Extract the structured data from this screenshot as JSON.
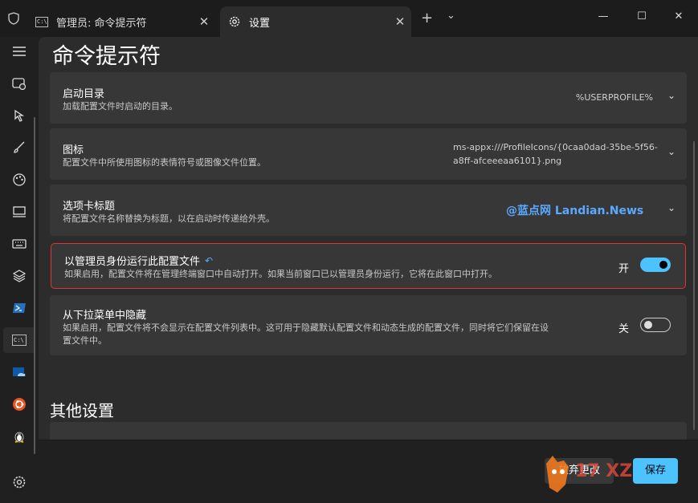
{
  "titlebar": {
    "tabs": [
      {
        "label": "管理员: 命令提示符",
        "icon": "cmd-icon",
        "close": "✕"
      },
      {
        "label": "设置",
        "icon": "gear-icon",
        "close": "✕"
      }
    ],
    "new_tab": "+",
    "dropdown": "⌄",
    "minimize": "—",
    "maximize": "☐",
    "close": "✕"
  },
  "sidebar": {
    "items": [
      {
        "name": "menu-icon"
      },
      {
        "name": "startup-icon"
      },
      {
        "name": "interaction-icon"
      },
      {
        "name": "appearance-icon"
      },
      {
        "name": "color-schemes-icon"
      },
      {
        "name": "rendering-icon"
      },
      {
        "name": "actions-icon"
      },
      {
        "name": "defaults-icon"
      },
      {
        "name": "powershell-icon"
      },
      {
        "name": "cmd-profile-icon"
      },
      {
        "name": "azure-icon"
      },
      {
        "name": "ubuntu-icon"
      },
      {
        "name": "linux-icon"
      },
      {
        "name": "settings-icon"
      }
    ],
    "active_index": 9
  },
  "main": {
    "title": "命令提示符",
    "cards": [
      {
        "title": "启动目录",
        "desc": "加载配置文件时启动的目录。",
        "value": "%USERPROFILE%"
      },
      {
        "title": "图标",
        "desc": "配置文件中所使用图标的表情符号或图像文件位置。",
        "value_line1": "ms-appx:///ProfileIcons/{0caa0dad-35be-5f56-",
        "value_line2": "a8ff-afceeeaa6101}.png"
      },
      {
        "title": "选项卡标题",
        "desc": "将配置文件名称替换为标题，以在启动时传递给外壳。",
        "watermark": "@蓝点网 Landian.News"
      },
      {
        "title": "以管理员身份运行此配置文件",
        "desc": "如果启用，配置文件将在管理终端窗口中自动打开。如果当前窗口已以管理员身份运行，它将在此窗口中打开。",
        "toggle_label": "开",
        "toggle_on": true
      },
      {
        "title": "从下拉菜单中隐藏",
        "desc_line1": "如果启用，配置文件将不会显示在配置文件列表中。这可用于隐藏默认配置文件和动态生成的配置文件，同时将它们保留在设",
        "desc_line2": "置文件中。",
        "toggle_label": "关",
        "toggle_on": false
      }
    ],
    "section_title": "其他设置"
  },
  "footer": {
    "discard": "放弃更改",
    "save": "保存"
  },
  "colors": {
    "accent": "#4cc2ff",
    "highlight_border": "#e63333",
    "card_bg": "#373737",
    "page_bg": "#2c2c2c"
  }
}
